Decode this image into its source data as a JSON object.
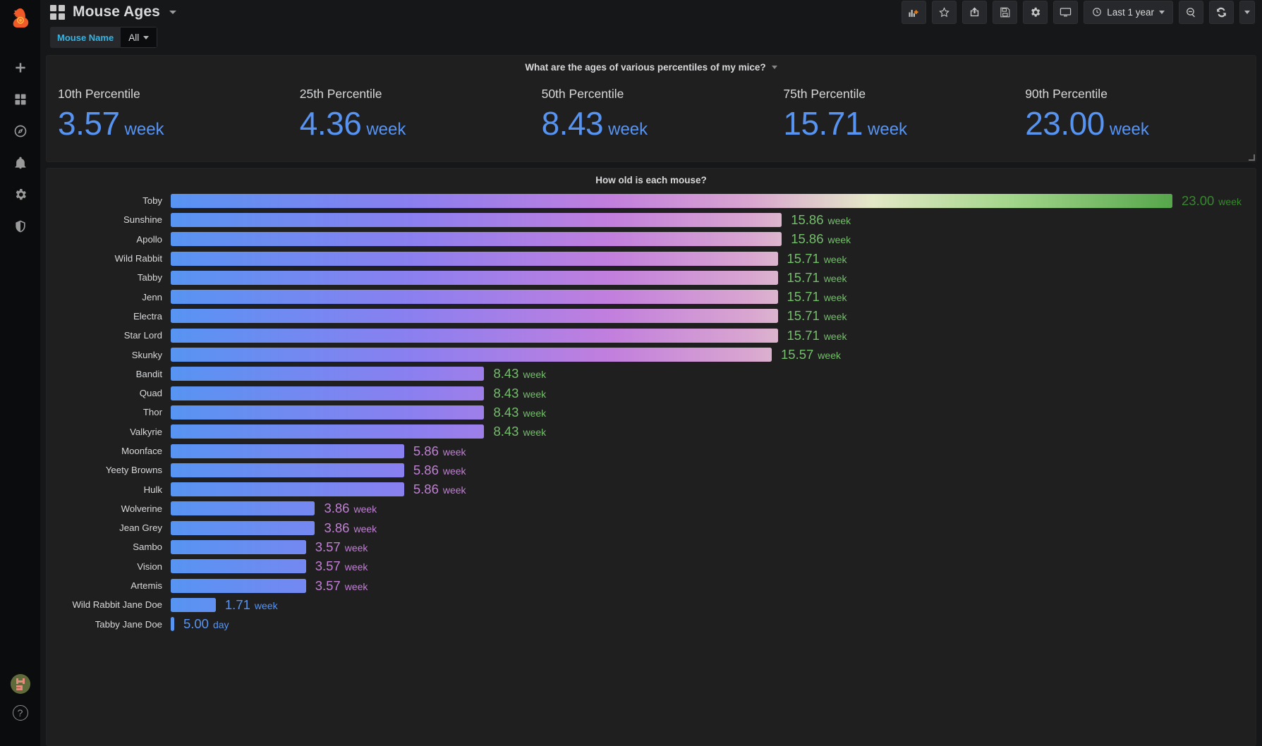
{
  "sidebar": {
    "logo_name": "grafana-logo",
    "items": [
      {
        "name": "create-icon",
        "label": "Create"
      },
      {
        "name": "dashboards-icon",
        "label": "Dashboards"
      },
      {
        "name": "explore-icon",
        "label": "Explore"
      },
      {
        "name": "alerting-icon",
        "label": "Alerting"
      },
      {
        "name": "configuration-icon",
        "label": "Configuration"
      },
      {
        "name": "server-admin-icon",
        "label": "Server Admin"
      }
    ],
    "avatar_label": "user-avatar",
    "help_label": "?"
  },
  "topnav": {
    "dashboard_title": "Mouse Ages",
    "grid_icon": "dashboard-grid-icon",
    "title_caret": "chevron-down-icon",
    "buttons": [
      {
        "name": "add-panel-button",
        "icon": "add-panel-icon",
        "label": "Add panel"
      },
      {
        "name": "mark-favorite-button",
        "icon": "star-icon",
        "label": "Mark as favorite"
      },
      {
        "name": "share-dashboard-button",
        "icon": "share-icon",
        "label": "Share dashboard"
      },
      {
        "name": "save-dashboard-button",
        "icon": "save-icon",
        "label": "Save dashboard"
      },
      {
        "name": "dashboard-settings-button",
        "icon": "gear-icon",
        "label": "Dashboard settings"
      },
      {
        "name": "kiosk-mode-button",
        "icon": "monitor-icon",
        "label": "Cycle view mode"
      }
    ],
    "time_range": "Last 1 year",
    "time_icon": "clock-icon",
    "zoom_out_label": "Zoom out time range",
    "zoom_out_icon": "search-minus-icon",
    "refresh_label": "Refresh dashboard",
    "refresh_icon": "refresh-icon",
    "refresh_caret": "chevron-down-icon"
  },
  "variables": [
    {
      "label": "Mouse Name",
      "value": "All",
      "caret": "chevron-down-icon"
    }
  ],
  "stat_panel": {
    "title": "What are the ages of various percentiles of my mice?",
    "caret": "chevron-down-icon",
    "value_color": "#5794f2",
    "stats": [
      {
        "name": "10th Percentile",
        "value": "3.57",
        "unit": "week"
      },
      {
        "name": "25th Percentile",
        "value": "4.36",
        "unit": "week"
      },
      {
        "name": "50th Percentile",
        "value": "8.43",
        "unit": "week"
      },
      {
        "name": "75th Percentile",
        "value": "15.71",
        "unit": "week"
      },
      {
        "name": "90th Percentile",
        "value": "23.00",
        "unit": "week"
      }
    ]
  },
  "bar_panel": {
    "title": "How old is each mouse?"
  },
  "chart_data": {
    "type": "bar",
    "title": "How old is each mouse?",
    "orientation": "horizontal",
    "xlabel": "",
    "ylabel": "",
    "unit": "week",
    "xlim": [
      0,
      23.0
    ],
    "grid": false,
    "legend": "none",
    "categories": [
      "Toby",
      "Sunshine",
      "Apollo",
      "Wild Rabbit",
      "Tabby",
      "Jenn",
      "Electra",
      "Star Lord",
      "Skunky",
      "Bandit",
      "Quad",
      "Thor",
      "Valkyrie",
      "Moonface",
      "Yeety Browns",
      "Hulk",
      "Wolverine",
      "Jean Grey",
      "Sambo",
      "Vision",
      "Artemis",
      "Wild Rabbit Jane Doe",
      "Tabby Jane Doe"
    ],
    "values": [
      23.0,
      15.86,
      15.86,
      15.71,
      15.71,
      15.71,
      15.71,
      15.71,
      15.57,
      8.43,
      8.43,
      8.43,
      8.43,
      5.86,
      5.86,
      5.86,
      3.86,
      3.86,
      3.57,
      3.57,
      3.57,
      1.71,
      0.714
    ],
    "display_values": [
      "23.00",
      "15.86",
      "15.86",
      "15.71",
      "15.71",
      "15.71",
      "15.71",
      "15.71",
      "15.57",
      "8.43",
      "8.43",
      "8.43",
      "8.43",
      "5.86",
      "5.86",
      "5.86",
      "3.86",
      "3.86",
      "3.57",
      "3.57",
      "3.57",
      "1.71",
      "5.00"
    ],
    "display_units": [
      "week",
      "week",
      "week",
      "week",
      "week",
      "week",
      "week",
      "week",
      "week",
      "week",
      "week",
      "week",
      "week",
      "week",
      "week",
      "week",
      "week",
      "week",
      "week",
      "week",
      "week",
      "week",
      "day"
    ],
    "value_colors": [
      "#37872d",
      "#73bf69",
      "#73bf69",
      "#73bf69",
      "#73bf69",
      "#73bf69",
      "#73bf69",
      "#73bf69",
      "#73bf69",
      "#73bf69",
      "#73bf69",
      "#73bf69",
      "#73bf69",
      "#c17fd4",
      "#c17fd4",
      "#c17fd4",
      "#c17fd4",
      "#c17fd4",
      "#c17fd4",
      "#c17fd4",
      "#c17fd4",
      "#5794f2",
      "#5794f2"
    ],
    "bar_widths_pct": [
      100.0,
      61.0,
      61.0,
      60.6,
      60.6,
      60.6,
      60.6,
      60.6,
      60.0,
      31.3,
      31.3,
      31.3,
      31.3,
      23.3,
      23.3,
      23.3,
      14.4,
      14.4,
      13.5,
      13.5,
      13.5,
      4.5,
      0.35
    ],
    "gradient_stops": [
      "#5794f2",
      "#8b7ff0",
      "#c27fdd",
      "#d9a6d0",
      "#e4e8c6",
      "#a2d68a",
      "#56a64b"
    ]
  }
}
